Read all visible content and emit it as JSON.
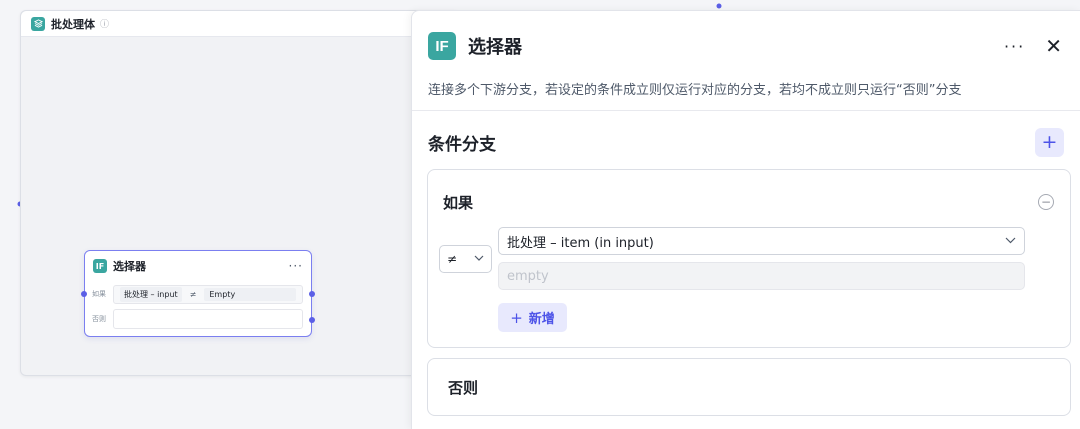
{
  "canvas": {
    "batch_title": "批处理体",
    "batch_info_icon": "info-icon",
    "node": {
      "badge": "IF",
      "title": "选择器",
      "more": "···",
      "if_label": "如果",
      "condition_left": "批处理 – input",
      "condition_op": "≠",
      "condition_right": "Empty",
      "else_label": "否则"
    }
  },
  "panel": {
    "badge": "IF",
    "title": "选择器",
    "more": "···",
    "close": "✕",
    "description": "连接多个下游分支，若设定的条件成立则仅运行对应的分支，若均不成立则只运行“否则”分支",
    "section_title": "条件分支",
    "add_branch": "+",
    "if_branch": {
      "label": "如果",
      "remove": "−",
      "operator": "≠",
      "variable": "批处理 – item (in input)",
      "value_placeholder": "empty",
      "add_condition": "新增",
      "add_condition_icon": "+"
    },
    "else_branch": {
      "label": "否则"
    }
  },
  "colors": {
    "accent": "#4d53e8",
    "accent_bg": "#e8e9fd",
    "badge": "#3aa6a0",
    "wire": "#5b5fe6"
  }
}
